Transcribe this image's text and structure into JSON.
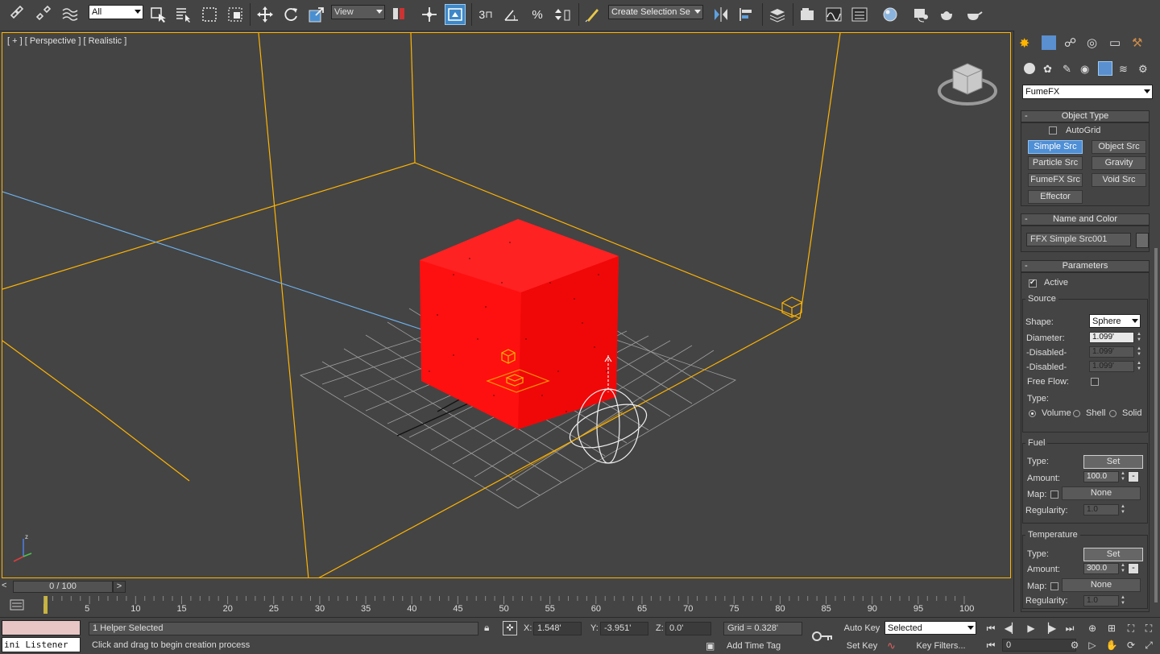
{
  "toolbar": {
    "selection_filter": "All",
    "ref_coord": "View",
    "snaps_label": "3",
    "named_selection_placeholder": "Create Selection Se"
  },
  "viewport": {
    "label": "[ + ] [ Perspective ] [ Realistic ]",
    "axis_z": "z",
    "axis_y": "y",
    "axis_x": "x"
  },
  "panel": {
    "category": "FumeFX",
    "object_type": {
      "title": "Object Type",
      "autogrid": "AutoGrid",
      "buttons": [
        "Simple Src",
        "Object Src",
        "Particle Src",
        "Gravity",
        "FumeFX Src",
        "Void Src",
        "Effector"
      ]
    },
    "name_color": {
      "title": "Name and Color",
      "name": "FFX Simple Src001",
      "swatch": "#6a6a6a"
    },
    "parameters": {
      "title": "Parameters",
      "active": "Active",
      "source_group": "Source",
      "shape_label": "Shape:",
      "shape_value": "Sphere",
      "diameter_label": "Diameter:",
      "diameter_value": "1.099'",
      "disabled1_label": "-Disabled-",
      "disabled1_value": "1.099'",
      "disabled2_label": "-Disabled-",
      "disabled2_value": "1.099'",
      "freeflow_label": "Free Flow:",
      "type_label": "Type:",
      "radio_volume": "Volume",
      "radio_shell": "Shell",
      "radio_solid": "Solid",
      "fuel_group": "Fuel",
      "fuel_type_label": "Type:",
      "fuel_type_btn": "Set",
      "fuel_amount_label": "Amount:",
      "fuel_amount": "100.0",
      "fuel_map_label": "Map:",
      "fuel_map_btn": "None",
      "fuel_regularity_label": "Regularity:",
      "fuel_regularity": "1.0",
      "temp_group": "Temperature",
      "temp_type_label": "Type:",
      "temp_type_btn": "Set",
      "temp_amount_label": "Amount:",
      "temp_amount": "300.0",
      "temp_map_label": "Map:",
      "temp_map_btn": "None",
      "temp_regularity_label": "Regularity:",
      "temp_regularity": "1.0"
    }
  },
  "timeline": {
    "frame_display": "0 / 100",
    "prev": "<",
    "next": ">",
    "ticks": [
      "5",
      "10",
      "15",
      "20",
      "25",
      "30",
      "35",
      "40",
      "45",
      "50",
      "55",
      "60",
      "65",
      "70",
      "75",
      "80",
      "85",
      "90",
      "95",
      "100"
    ]
  },
  "status": {
    "listener": "ini Listener",
    "selection_msg": "1 Helper Selected",
    "prompt_msg": "Click and drag to begin creation process",
    "x_label": "X:",
    "x_value": "1.548'",
    "y_label": "Y:",
    "y_value": "-3.951'",
    "z_label": "Z:",
    "z_value": "0.0'",
    "grid": "Grid = 0.328'",
    "add_time_tag": "Add Time Tag",
    "auto_key": "Auto Key",
    "set_key": "Set Key",
    "key_mode": "Selected",
    "key_filters": "Key Filters...",
    "frame_field": "0"
  },
  "colors": {
    "selection_highlight": "#ffb400",
    "fire": "#ff1010",
    "accent": "#4f8fd6"
  }
}
